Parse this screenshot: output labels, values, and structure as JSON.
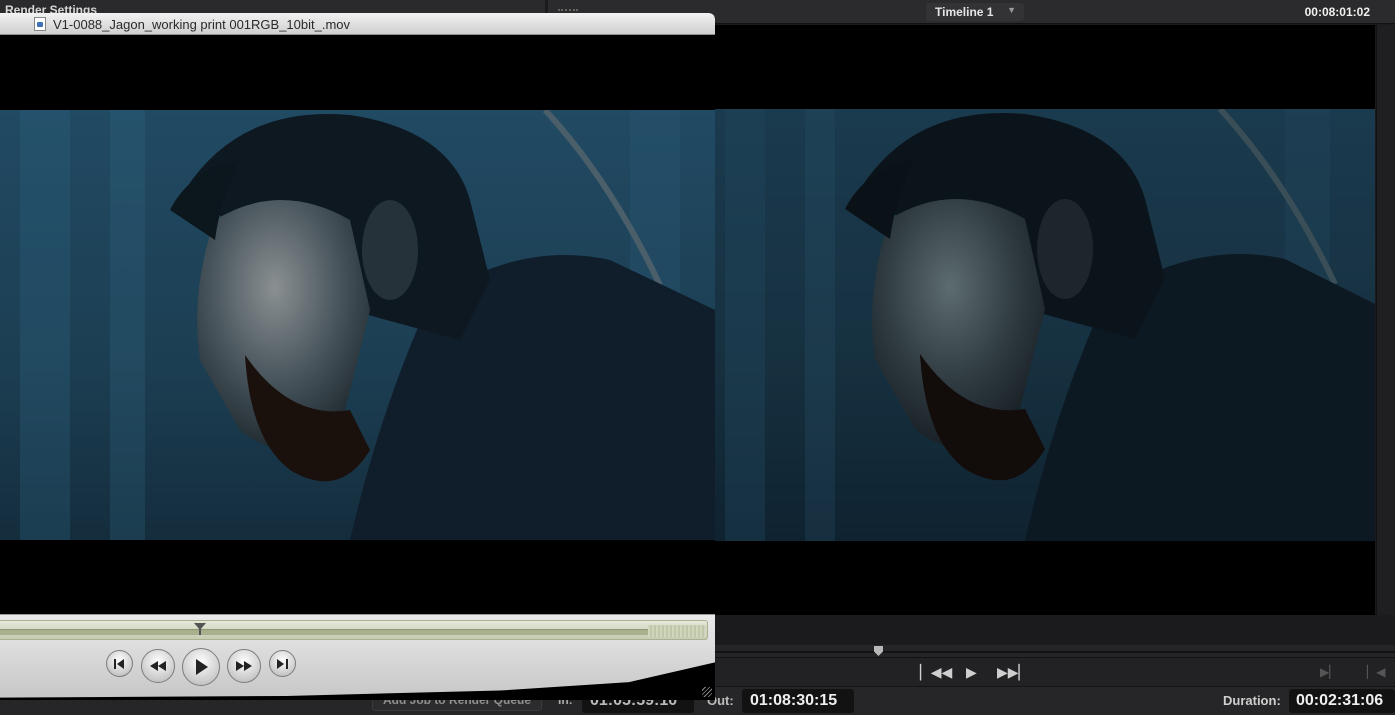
{
  "render_settings": {
    "title": "Render Settings"
  },
  "viewer": {
    "timeline_select": "Timeline 1",
    "top_timecode": "00:08:01:02"
  },
  "bottom": {
    "add_job_label": "Add Job to Render Queue",
    "in_label": "In:",
    "in_timecode": "01:05:59:10",
    "out_label": "Out:",
    "out_timecode": "01:08:30:15",
    "duration_label": "Duration:",
    "duration_timecode": "00:02:31:06"
  },
  "quicktime": {
    "filename": "V1-0088_Jagon_working print 001RGB_10bit_.mov",
    "playhead_fraction": 0.28
  },
  "colors": {
    "resolve_bg": "#1b1b1d",
    "qt_chrome": "#dcdcdc",
    "scrubber_green": "#c4cbb1"
  },
  "icons": {
    "viewer_transport": [
      "skip-back-icon",
      "play-icon",
      "skip-forward-icon"
    ],
    "qt_transport": [
      "go-to-start-icon",
      "rewind-icon",
      "play-icon",
      "fast-forward-icon",
      "go-to-end-icon"
    ]
  }
}
